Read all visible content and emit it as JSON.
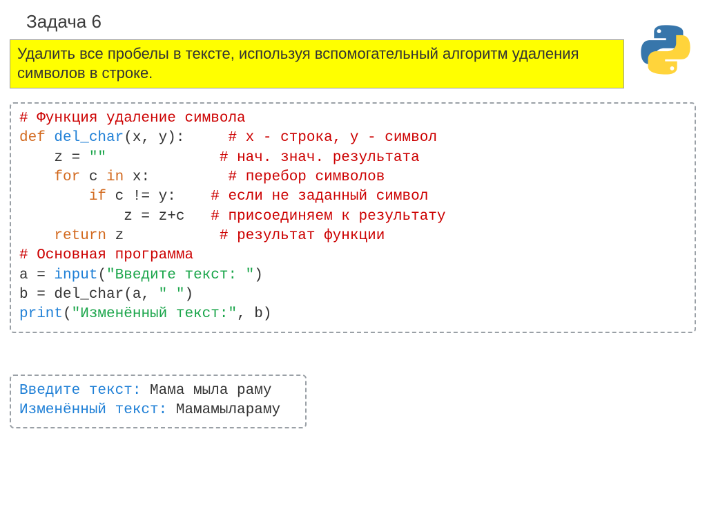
{
  "title": "Задача 6",
  "task_description": "Удалить все пробелы в тексте, используя вспомогательный алгоритм удаления символов в строке.",
  "code": {
    "l1_comment": "# Функция удаление символа",
    "l2_def": "def",
    "l2_name": " del_char",
    "l2_rest": "(x, y):     ",
    "l2_comment": "# х - строка, y - символ",
    "l3_pre": "    z = ",
    "l3_str": "\"\"",
    "l3_pad": "             ",
    "l3_comment": "# нач. знач. результата",
    "l4_for": "    for",
    "l4_mid1": " c ",
    "l4_in": "in",
    "l4_mid2": " x:         ",
    "l4_comment": "# перебор символов",
    "l5_if": "        if",
    "l5_mid": " c != y:    ",
    "l5_comment": "# если не заданный символ",
    "l6_body": "            z = z+c   ",
    "l6_comment": "# присоединяем к результату",
    "l7_ret": "    return",
    "l7_mid": " z           ",
    "l7_comment": "# результат функции",
    "l8_comment": "# Основная программа",
    "l9_a": "a = ",
    "l9_input": "input",
    "l9_paren1": "(",
    "l9_str": "\"Введите текст: \"",
    "l9_paren2": ")",
    "l10_b": "b = del_char(a, ",
    "l10_str": "\" \"",
    "l10_end": ")",
    "l11_print": "print",
    "l11_paren1": "(",
    "l11_str": "\"Изменённый текст:\"",
    "l11_rest": ", b)"
  },
  "output": {
    "p1_label": "Введите текст: ",
    "p1_value": "Мама мыла раму",
    "p2_label": "Изменённый текст: ",
    "p2_value": "Мамамылараму"
  }
}
